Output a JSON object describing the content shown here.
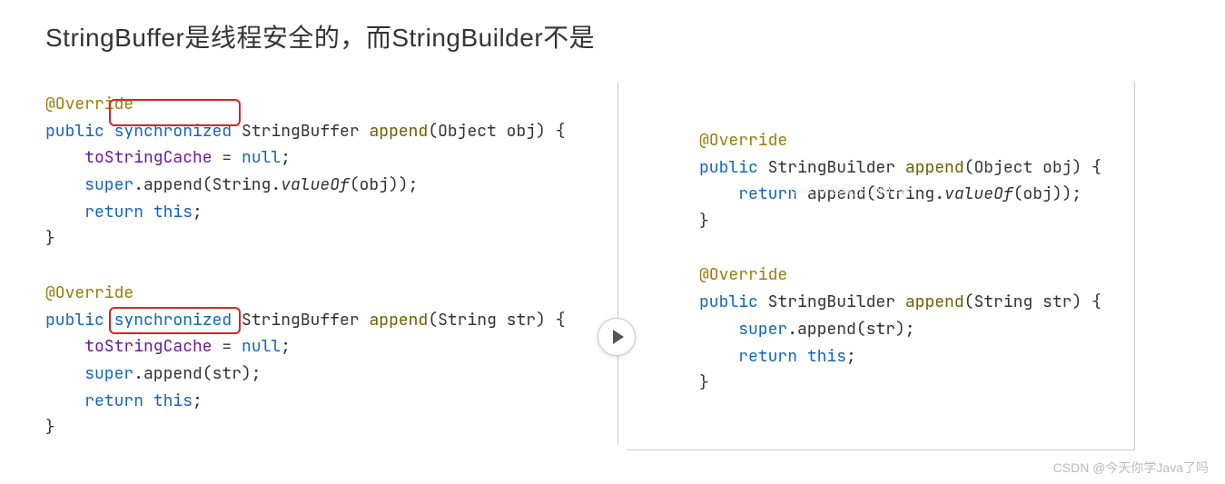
{
  "title": "StringBuffer是线程安全的，而StringBuilder不是",
  "left": {
    "block1": {
      "ann": "@Override",
      "kw_public": "public",
      "kw_sync": "synchronized",
      "type": "StringBuffer",
      "method": "append",
      "params": "(Object obj) {",
      "line1_field": "toStringCache",
      "line1_rest": " = ",
      "line1_null": "null",
      "line1_semi": ";",
      "line2_super": "super",
      "line2_dot": ".append(String.",
      "line2_valueof": "valueOf",
      "line2_end": "(obj));",
      "line3_ret": "return",
      "line3_this": "this",
      "line3_semi": ";",
      "close": "}"
    },
    "block2": {
      "ann": "@Override",
      "kw_public": "public",
      "kw_sync": "synchronized",
      "type": "StringBuffer",
      "method": "append",
      "params": "(String str) {",
      "line1_field": "toStringCache",
      "line1_rest": " = ",
      "line1_null": "null",
      "line1_semi": ";",
      "line2_super": "super",
      "line2_rest": ".append(str);",
      "line3_ret": "return",
      "line3_this": "this",
      "line3_semi": ";",
      "close": "}"
    }
  },
  "right": {
    "block1": {
      "ann": "@Override",
      "kw_public": "public",
      "type": "StringBuilder",
      "method": "append",
      "params": "(Object obj) {",
      "line1_ret": "return",
      "line1_rest": " append(String.",
      "line1_valueof": "valueOf",
      "line1_end": "(obj));",
      "close": "}"
    },
    "block2": {
      "ann": "@Override",
      "kw_public": "public",
      "type": "StringBuilder",
      "method": "append",
      "params": "(String str) {",
      "line1_super": "super",
      "line1_rest": ".append(str);",
      "line2_ret": "return",
      "line2_this": "this",
      "line2_semi": ";",
      "close": "}"
    }
  },
  "watermark": "CSDN @今天你学Java了吗",
  "faded_watermark": "lsuu_李佳琛_E_txvcevn"
}
